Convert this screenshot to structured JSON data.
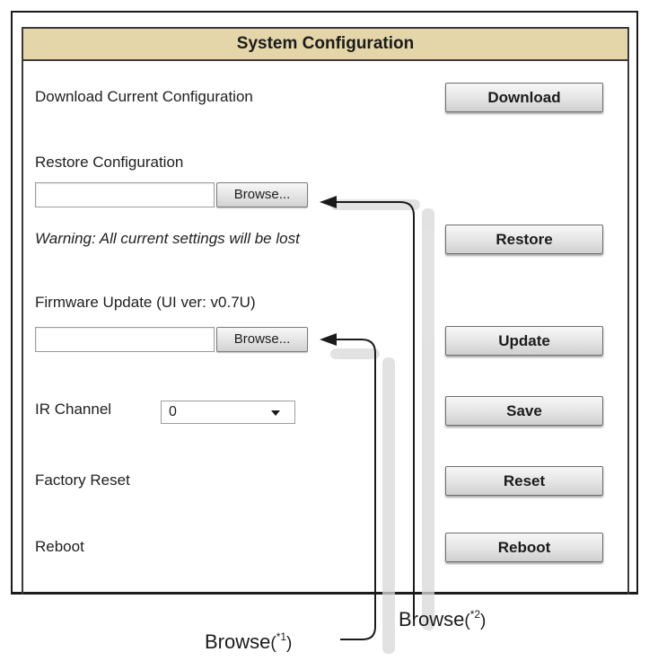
{
  "panel": {
    "title": "System Configuration"
  },
  "rows": {
    "download": {
      "label": "Download Current Configuration",
      "button": "Download"
    },
    "restore": {
      "label": "Restore Configuration",
      "browse": "Browse...",
      "file_value": "",
      "warning": "Warning: All current settings will be lost",
      "button": "Restore"
    },
    "firmware": {
      "label": "Firmware Update (UI ver: v0.7U)",
      "browse": "Browse...",
      "file_value": "",
      "button": "Update"
    },
    "ir_channel": {
      "label": "IR Channel",
      "selected": "0",
      "button": "Save"
    },
    "factory_reset": {
      "label": "Factory Reset",
      "button": "Reset"
    },
    "reboot": {
      "label": "Reboot",
      "button": "Reboot"
    }
  },
  "callouts": {
    "browse1": {
      "text": "Browse",
      "note": "*1"
    },
    "browse2": {
      "text": "Browse",
      "note": "*2"
    }
  },
  "icons": {
    "select_caret": "chevron-down-icon",
    "callout_arrow": "arrow-left-icon"
  },
  "colors": {
    "header_bg": "#e4d6a9",
    "border": "#1b1b1b"
  }
}
